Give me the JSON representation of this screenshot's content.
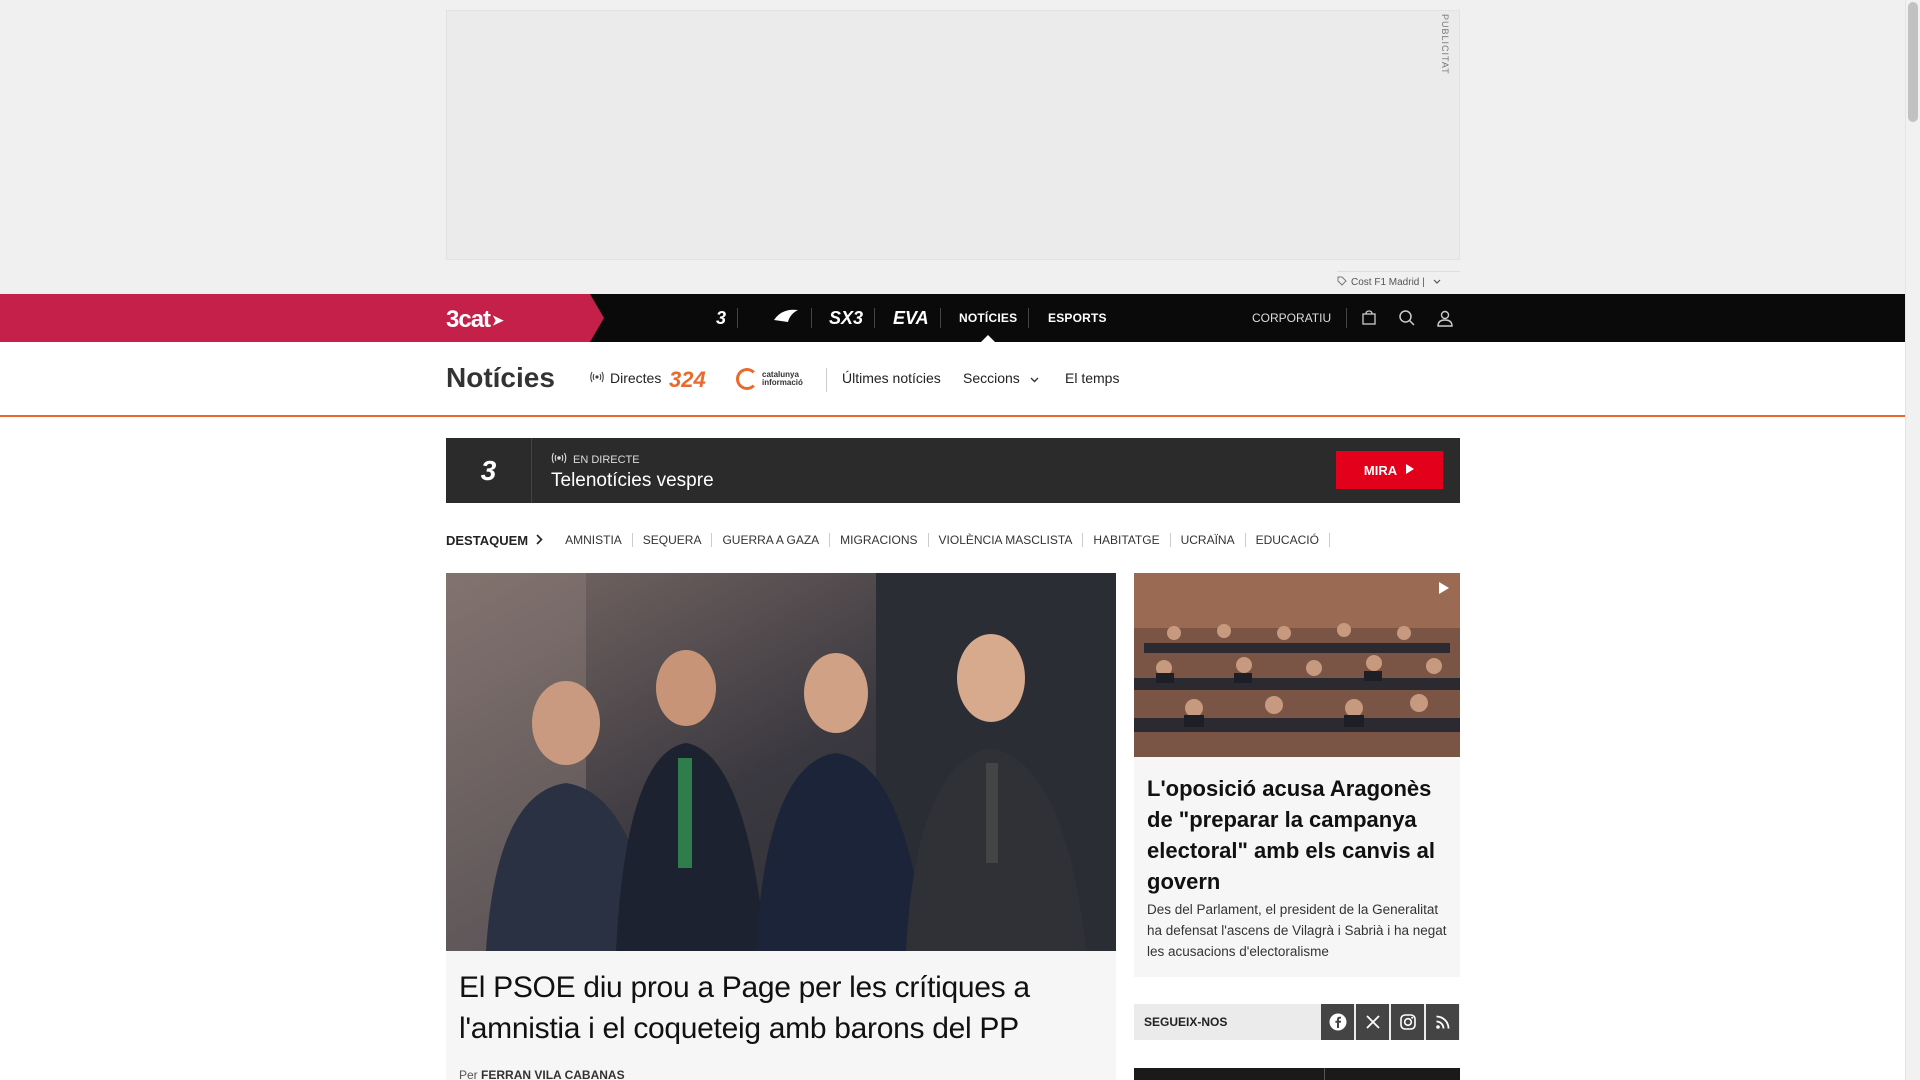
{
  "ad": {
    "label": "PUBLICITAT",
    "caption": "Cost F1 Madrid |"
  },
  "topbar": {
    "brand": "3cat",
    "channels": [
      {
        "label": "3",
        "kind": "logo"
      },
      {
        "label": "Cat ràdio",
        "kind": "logo"
      },
      {
        "label": "SX3",
        "kind": "logo"
      },
      {
        "label": "EVA",
        "kind": "logo"
      },
      {
        "label": "NOTÍCIES",
        "kind": "text",
        "active": true
      },
      {
        "label": "ESPORTS",
        "kind": "text"
      }
    ],
    "corporate": "CORPORATIU",
    "icons": [
      "shopping-bag-icon",
      "search-icon",
      "user-icon"
    ]
  },
  "section_nav": {
    "title": "Notícies",
    "directes": "Directes",
    "logo_324": "324",
    "logo_ci": "catalunya informació",
    "items": [
      "Últimes notícies",
      "Seccions",
      "El temps"
    ]
  },
  "live": {
    "channel": "3",
    "label": "EN DIRECTE",
    "title": "Telenotícies vespre",
    "button": "MIRA"
  },
  "tags": {
    "heading": "DESTAQUEM",
    "items": [
      "AMNISTIA",
      "SEQUERA",
      "GUERRA A GAZA",
      "MIGRACIONS",
      "VIOLÈNCIA MASCLISTA",
      "HABITATGE",
      "UCRAÏNA",
      "EDUCACIÓ"
    ]
  },
  "main_story": {
    "title": "El PSOE diu prou a Page per les crítiques a l'amnistia i el coqueteig amb barons del PP",
    "by_prefix": "Per",
    "author": "FERRAN VILA CABANAS"
  },
  "side_story": {
    "title": "L'oposició acusa Aragonès de \"preparar la campanya electoral\" amb els canvis al govern",
    "description": "Des del Parlament, el president de la Generalitat ha defensat l'ascens de Vilagrà i Sabrià i ha negat les acusacions d'electoralisme"
  },
  "follow": {
    "label": "SEGUEIX-NOS",
    "networks": [
      "facebook-icon",
      "x-icon",
      "instagram-icon",
      "rss-icon"
    ]
  },
  "colors": {
    "brand_red": "#c4204a",
    "accent_orange": "#e96a2c",
    "live_button": "#e2001a"
  }
}
